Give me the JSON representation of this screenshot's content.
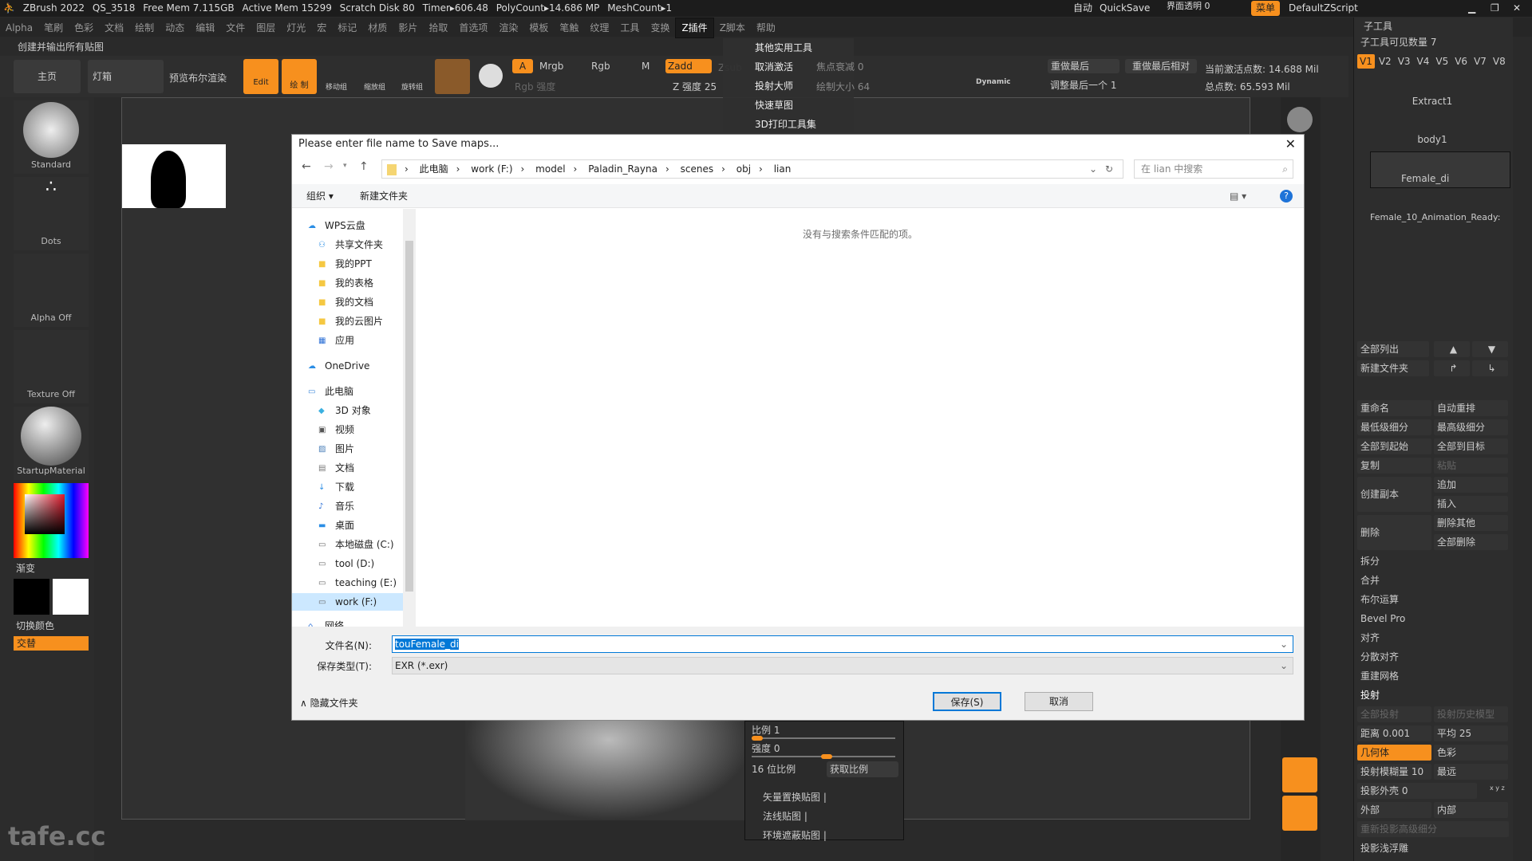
{
  "titlebar": {
    "app": "ZBrush 2022",
    "project": "QS_3518",
    "free_mem": "Free Mem 7.115GB",
    "active_mem": "Active Mem 15299",
    "scratch": "Scratch Disk 80",
    "timer": "Timer▸606.48",
    "polycount": "PolyCount▸14.686 MP",
    "meshcount": "MeshCount▸1",
    "auto": "自动",
    "quicksave": "QuickSave",
    "transparency": "界面透明 0",
    "menu": "菜单",
    "script": "DefaultZScript"
  },
  "menubar": [
    "Alpha",
    "笔刷",
    "色彩",
    "文档",
    "绘制",
    "动态",
    "编辑",
    "文件",
    "图层",
    "灯光",
    "宏",
    "标记",
    "材质",
    "影片",
    "拾取",
    "首选项",
    "渲染",
    "模板",
    "笔触",
    "纹理",
    "工具",
    "变换",
    "Z插件",
    "Z脚本",
    "帮助"
  ],
  "active_menu": "Z插件",
  "subtitle": "创建并输出所有贴图",
  "toolbar": {
    "home": "主页",
    "lightbox": "灯箱",
    "preview": "预览布尔渲染",
    "edit": "Edit",
    "draw": "绘 制",
    "move": "移动组",
    "scale": "缩放组",
    "rotate": "旋转组",
    "a": "A",
    "mrgb": "Mrgb",
    "rgb": "Rgb",
    "m": "M",
    "zadd": "Zadd",
    "zsub": "Zsub",
    "rgb_intensity": "Rgb 强度",
    "z_intensity": "Z 强度 25",
    "focal": "焦点衰减 0",
    "draw_size": "绘制大小 64",
    "dynamic": "Dynamic",
    "redo_last": "重做最后",
    "redo_last_rel": "重做最后相对",
    "adjust_last": "调整最后一个 1",
    "active_points": "当前激活点数: 14.688 Mil",
    "total_points": "总点数: 65.593 Mil"
  },
  "zplugin_menu": [
    "其他实用工具",
    "取消激活",
    "投射大师",
    "快速草图",
    "3D打印工具集"
  ],
  "left_panel": {
    "brush": "Standard",
    "stroke": "Dots",
    "alpha": "Alpha Off",
    "texture": "Texture Off",
    "material": "StartupMaterial",
    "gradient": "渐变",
    "switch_color": "切换颜色",
    "alternate": "交替"
  },
  "dialog": {
    "title": "Please enter file name to Save maps...",
    "path": [
      "此电脑",
      "work (F:)",
      "model",
      "Paladin_Rayna",
      "scenes",
      "obj",
      "lian"
    ],
    "search_placeholder": "在 lian 中搜索",
    "organize": "组织 ▾",
    "new_folder": "新建文件夹",
    "nav": [
      {
        "label": "WPS云盘",
        "icon": "cloud"
      },
      {
        "label": "共享文件夹",
        "icon": "share"
      },
      {
        "label": "我的PPT",
        "icon": "folder"
      },
      {
        "label": "我的表格",
        "icon": "folder"
      },
      {
        "label": "我的文档",
        "icon": "folder"
      },
      {
        "label": "我的云图片",
        "icon": "folder"
      },
      {
        "label": "应用",
        "icon": "apps"
      },
      {
        "label": "OneDrive",
        "icon": "cloud"
      },
      {
        "label": "此电脑",
        "icon": "pc"
      },
      {
        "label": "3D 对象",
        "icon": "3d"
      },
      {
        "label": "视频",
        "icon": "video"
      },
      {
        "label": "图片",
        "icon": "pictures"
      },
      {
        "label": "文档",
        "icon": "docs"
      },
      {
        "label": "下载",
        "icon": "download"
      },
      {
        "label": "音乐",
        "icon": "music"
      },
      {
        "label": "桌面",
        "icon": "desktop"
      },
      {
        "label": "本地磁盘 (C:)",
        "icon": "drive"
      },
      {
        "label": "tool (D:)",
        "icon": "drive"
      },
      {
        "label": "teaching (E:)",
        "icon": "drive"
      },
      {
        "label": "work (F:)",
        "icon": "drive"
      },
      {
        "label": "网络",
        "icon": "network"
      }
    ],
    "empty_message": "没有与搜索条件匹配的项。",
    "filename_label": "文件名(N):",
    "filename": "touFemale_di",
    "type_label": "保存类型(T):",
    "type": "EXR (*.exr)",
    "hide_folders": "隐藏文件夹",
    "save": "保存(S)",
    "cancel": "取消"
  },
  "bottom_panel": {
    "scale": "比例 1",
    "intensity": "强度 0",
    "bit16": "16 位比例",
    "get_scale": "获取比例",
    "vector_disp": "矢量置换贴图 |",
    "normal": "法线贴图 |",
    "ao": "环境遮蔽贴图 |"
  },
  "right_panel": {
    "title": "子工具",
    "visible_count": "子工具可见数量 7",
    "versions": [
      "V1",
      "V2",
      "V3",
      "V4",
      "V5",
      "V6",
      "V7",
      "V8"
    ],
    "subtools": [
      "Extract1",
      "body1",
      "Female_di",
      "Female_10_Animation_Ready:"
    ],
    "list_all": "全部列出",
    "new_folder": "新建文件夹",
    "rename": "重命名",
    "auto_reorder": "自动重排",
    "lowest_sub": "最低级细分",
    "highest_sub": "最高级细分",
    "all_to_start": "全部到起始",
    "all_to_target": "全部到目标",
    "copy": "复制",
    "paste": "粘贴",
    "duplicate": "创建副本",
    "append": "追加",
    "insert": "插入",
    "delete": "删除",
    "delete_other": "删除其他",
    "delete_all": "全部删除",
    "sections": [
      "拆分",
      "合并",
      "布尔运算",
      "Bevel Pro",
      "对齐",
      "分散对齐",
      "重建网格"
    ],
    "project": "投射",
    "project_all": "全部投射",
    "project_history": "投射历史模型",
    "distance": "距离 0.001",
    "mean": "平均 25",
    "geometry": "几何体",
    "color": "色彩",
    "blur": "投射模糊量 10",
    "farthest": "最远",
    "shell": "投影外壳 0",
    "xyz": "x y z",
    "outer": "外部",
    "inner": "内部",
    "reproject": "重新投影高级细分",
    "bas_relief": "投影浅浮雕"
  },
  "watermark": "tafe.cc",
  "accent": "#f7901e"
}
